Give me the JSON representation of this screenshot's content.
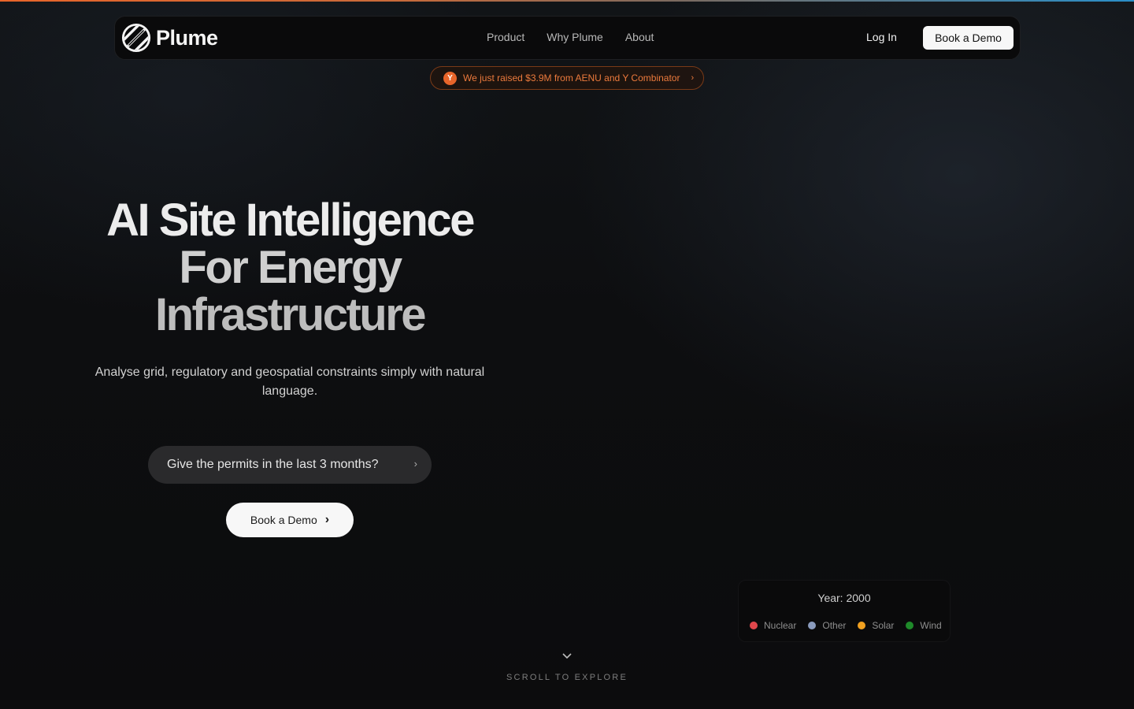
{
  "nav": {
    "brand": "Plume",
    "links": [
      "Product",
      "Why Plume",
      "About"
    ],
    "login": "Log In",
    "cta": "Book a Demo"
  },
  "announcement": {
    "badge": "Y",
    "text": "We just raised $3.9M from AENU and Y Combinator",
    "chevron": "›"
  },
  "hero": {
    "title_lines": [
      "AI Site Intelligence",
      "For Energy",
      "Infrastructure"
    ],
    "subtitle": "Analyse grid, regulatory and geospatial constraints simply with natural language.",
    "query": "Give the permits in the last 3 months?",
    "query_chevron": "›",
    "cta": "Book a Demo",
    "cta_chevron": "›"
  },
  "legend": {
    "year_label": "Year: 2000",
    "items": [
      {
        "label": "Nuclear",
        "color": "#e0474c"
      },
      {
        "label": "Other",
        "color": "#8a9bbd"
      },
      {
        "label": "Solar",
        "color": "#f0a020"
      },
      {
        "label": "Wind",
        "color": "#1f8a2a"
      }
    ]
  },
  "scroll": {
    "label": "SCROLL TO EXPLORE",
    "icon": "chevron-down-icon"
  },
  "colors": {
    "accent_orange": "#e8652a",
    "background": "#0d0d0e"
  }
}
